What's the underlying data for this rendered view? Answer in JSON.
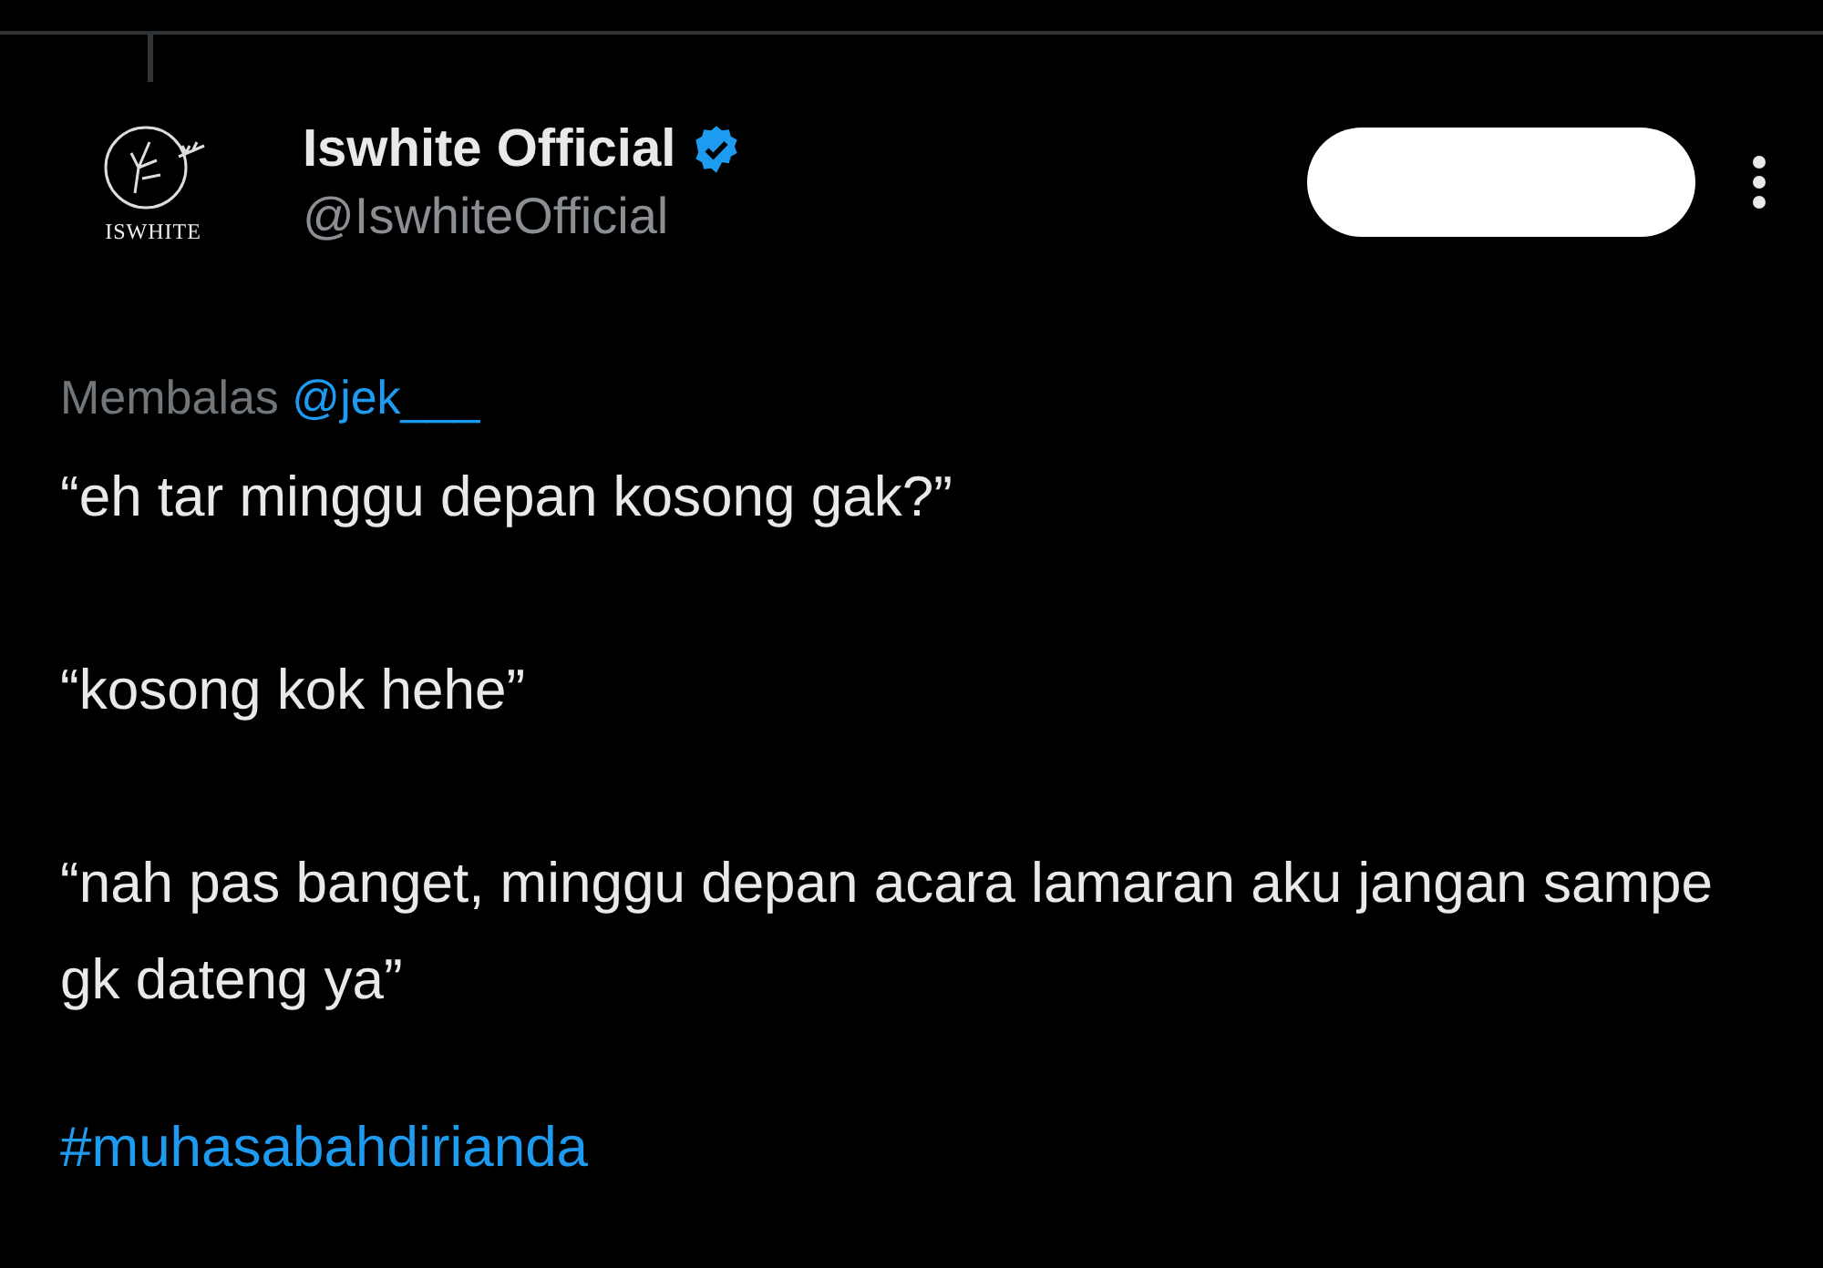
{
  "author": {
    "name": "Iswhite Official",
    "verified": true,
    "handle": "@IswhiteOfficial",
    "logo_text": "ISWHITE"
  },
  "reply_to": {
    "label": "Membalas",
    "mention": "@jek___"
  },
  "paragraphs": [
    "“eh tar minggu depan kosong gak?”",
    "“kosong kok hehe”",
    "“nah pas banget, minggu depan acara lamaran aku jangan sampe gk dateng ya”"
  ],
  "hashtag": "#muhasabahdirianda"
}
